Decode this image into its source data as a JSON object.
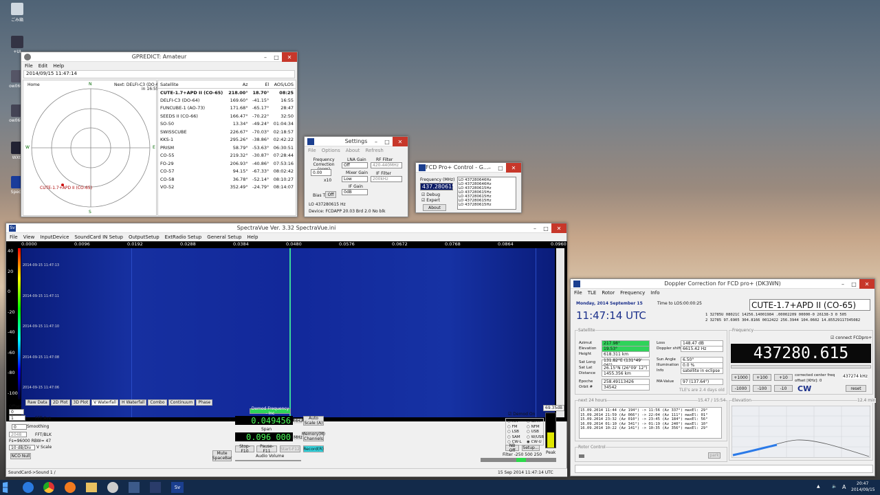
{
  "desktop": {
    "icons": [
      {
        "label": "ごみ箱"
      },
      {
        "label": "+UI"
      },
      {
        "label": "ow0662"
      },
      {
        "label": "ow0662"
      },
      {
        "label": "WXtr"
      },
      {
        "label": "Specti"
      }
    ]
  },
  "gpredict": {
    "title": "GPREDICT: Amateur",
    "menu": [
      "File",
      "Edit",
      "Help"
    ],
    "datetime": "2014/09/15 11:47:14",
    "polar": {
      "home": "Home",
      "next": "Next: DELFI-C3 (DO-64)",
      "next_time": "in 16:55",
      "n": "N",
      "s": "S",
      "e": "E",
      "w": "W",
      "sat": "CUTE-1.7+APD II (CO-65)"
    },
    "headers": [
      "Satellite",
      "Az",
      "El",
      "AOS/LOS"
    ],
    "rows": [
      [
        "CUTE-1.7+APD II (CO-65)",
        "218.00°",
        "18.70°",
        "08:25"
      ],
      [
        "DELFI-C3 (DO-64)",
        "169.60°",
        "-41.15°",
        "16:55"
      ],
      [
        "FUNCUBE-1 (AO-73)",
        "171.68°",
        "-65.17°",
        "28:47"
      ],
      [
        "SEEDS II (CO-66)",
        "166.47°",
        "-70.22°",
        "32:50"
      ],
      [
        "SO-50",
        "13.34°",
        "-49.24°",
        "01:04:34"
      ],
      [
        "SWISSCUBE",
        "226.67°",
        "-70.03°",
        "02:18:57"
      ],
      [
        "KKS-1",
        "295.26°",
        "-38.86°",
        "02:42:22"
      ],
      [
        "PRISM",
        "58.79°",
        "-53.63°",
        "06:30:51"
      ],
      [
        "CO-55",
        "219.32°",
        "-30.87°",
        "07:28:44"
      ],
      [
        "FO-29",
        "206.93°",
        "-40.86°",
        "07:53:16"
      ],
      [
        "CO-57",
        "94.15°",
        "-67.33°",
        "08:02:42"
      ],
      [
        "CO-58",
        "36.78°",
        "-52.14°",
        "08:10:27"
      ],
      [
        "VO-52",
        "352.49°",
        "-24.79°",
        "08:14:07"
      ]
    ]
  },
  "settings": {
    "title": "Settings",
    "menu": [
      "File",
      "Options",
      "About",
      "Refresh"
    ],
    "freq_corr": "Frequency Correction (ppm)",
    "freq_corr_val": "0.00",
    "x10": "x10",
    "bias_t": "Bias T",
    "bias_off": "Off",
    "lna": "LNA Gain",
    "lna_val": "Off",
    "mixer": "Mixer Gain",
    "mixer_val": "Low",
    "if": "IF Gain",
    "if_val": "0dB",
    "rf_filter": "RF Filter",
    "rf_val": "420-440MHz",
    "if_filter": "IF Filter",
    "if_filter_val": "200kHz",
    "lo": "LO 437280615 Hz",
    "device": "Device: FCDAPP 20.03 Brd 2.0 No blk"
  },
  "fcd": {
    "title": "FCD Pro+ Control - G...",
    "freq_label": "Frequency (MHz)",
    "freq": "437.280615",
    "debug": "Debug",
    "expert": "Expert",
    "about": "About",
    "list": [
      "LO 437280646Hz",
      "LO 437280646Hz",
      "LO 437280615Hz",
      "LO 437280615Hz",
      "LO 437280615Hz",
      "LO 437280615Hz",
      "LO 437280615Hz"
    ]
  },
  "spectravue": {
    "title": "SpectraVue Ver. 3.32   SpectraVue.ini",
    "menu": [
      "File",
      "View",
      "InputDevice",
      "SoundCard IN Setup",
      "OutputSetup",
      "ExtRadio Setup",
      "General Setup",
      "Help"
    ],
    "freq_ticks": [
      "0.0000",
      "0.0096",
      "0.0192",
      "0.0288",
      "0.0384",
      "0.0480",
      "0.0576",
      "0.0672",
      "0.0768",
      "0.0864",
      "0.0960"
    ],
    "db_ticks": [
      "40",
      "20",
      "0",
      "-20",
      "-40",
      "-60",
      "-80",
      "-100"
    ],
    "timestamps": [
      "2014-09-15 11:47:13",
      "2014-09-15 11:47:11",
      "2014-09-15 11:47:10",
      "2014-09-15 11:47:08",
      "2014-09-15 11:47:06"
    ],
    "tabs": [
      "Raw Data",
      "2D Plot",
      "3D Plot",
      "V Waterfall",
      "H Waterfall",
      "Combo",
      "Continuum",
      "Phase"
    ],
    "db_right": "69.35dB",
    "offset": "Offset",
    "offset_val": "0",
    "fft_ave": "FFT Ave",
    "fft_ave_val": "1",
    "smoothing": "Smoothing",
    "smoothing_val": "0",
    "fft_blk": "FFT/BLK",
    "fft_blk_val": "2048",
    "fs": "Fs=96000 RBW= 47",
    "vscale": "V Scale",
    "vscale_val": "10 dB/Div",
    "nco": "NCO Null",
    "demod_freq": "Demod Frequency - Inc",
    "l_freq": "0.049456",
    "span_label": "Span",
    "span_val": "0.096 000",
    "mhz": "MHz",
    "khz": "kHz",
    "l": "L",
    "autoscale": "Auto Scale (A)",
    "memory": "Memory(M) Channels",
    "mute": "Mute SpaceBar",
    "stop": "Stop-F10",
    "pause": "Pause-F11",
    "start": "Start-F12",
    "record": "Record(R)",
    "audio": "Audio Volume",
    "demod_on": "Demod On",
    "modes": [
      "AM",
      "WFM",
      "FM",
      "NFM",
      "LSB",
      "USB",
      "SAM",
      "W/USB",
      "CW-L",
      "CW-U"
    ],
    "nb": "NB Off",
    "setup": "Setup...",
    "peak": "Peak",
    "filter": "Filter -250   500   250",
    "status_left": "SoundCard->Sound 1  /",
    "status_right": "15 Sep 2014  11:47:14 UTC"
  },
  "doppler": {
    "title": "Doppler Correction for FCD pro+ (DK3WN)",
    "menu": [
      "File",
      "TLE",
      "Rotor",
      "Frequency",
      "Info"
    ],
    "date": "Monday, 2014 September 15",
    "time": "11:47:14 UTC",
    "tlos_label": "Time to LOS:",
    "tlos": "00:00:25",
    "sat": "CUTE-1.7+APD II (CO-65)",
    "tle1": "1 32785U 08021C   14256.14001984  .00002209  00000-0  26138-3 0  505",
    "tle2": "2 32785  97.6905 304.8166 0012422 256.3944 104.0602 14.85529117345082",
    "sat_box": "Satellite",
    "fields": [
      [
        "Azimut",
        "217.98°"
      ],
      [
        "Elevation",
        "19.53°"
      ],
      [
        "Height",
        "618.311 km"
      ],
      [
        "Sat Long",
        "131.82°E  (131°49' 06\")"
      ],
      [
        "Sat Lat",
        "26.15°N  (26°09' 12\")"
      ],
      [
        "Distance",
        "1455.356 km"
      ],
      [
        "Epoche",
        "258.49113426"
      ],
      [
        "Orbit #",
        "34542"
      ]
    ],
    "fields2": [
      [
        "Loss",
        "148.47 dB"
      ],
      [
        "Doppler shift",
        "6615.42 Hz"
      ],
      [
        "Sun Angle",
        "6.50°"
      ],
      [
        "Illumination",
        "0.0 %"
      ],
      [
        "Info",
        "satellite in eclipse"
      ],
      [
        "MA-Value",
        "97  (137.64°)"
      ]
    ],
    "tle_age": "TLE's are 2.4 days old",
    "freq_box": "Frequency",
    "connect": "connect FCDpro+",
    "freq": "437280.615",
    "btns_up": [
      "+1000",
      "+100",
      "+10"
    ],
    "btns_dn": [
      "-1000",
      "-100",
      "-10"
    ],
    "center_label": "corrected center freq",
    "center_val": "437274 kHz",
    "offset_label": "offset [KHz]: 0",
    "cw": "CW",
    "reset": "reset",
    "next24": "next 24 hours",
    "next24_time": "15.47 / 15:54",
    "passes": [
      "15.09.2014 11:44 (Az 194°) -> 11:56 (Az 337°)  maxEl: 29°",
      "15.09.2014 21:59 (Az 066°) -> 22:04 (Az 111°)  maxEl: 01°",
      "15.09.2014 23:32 (Az 010°) -> 23:45 (Az 184°)  maxEl: 56°",
      "16.09.2014 01:10 (Az 341°) -> 01:19 (Az 240°)  maxEl: 10°",
      "16.09.2014 10:22 (Az 141°) -> 10:35 (Az 356°)  maxEl: 29°"
    ],
    "elev": "Elevation",
    "elev_time": "12.4 min",
    "rotor": "Rotor Control",
    "park": "park"
  },
  "taskbar": {
    "time": "20:47",
    "date": "2014/09/15",
    "ime": "A"
  }
}
